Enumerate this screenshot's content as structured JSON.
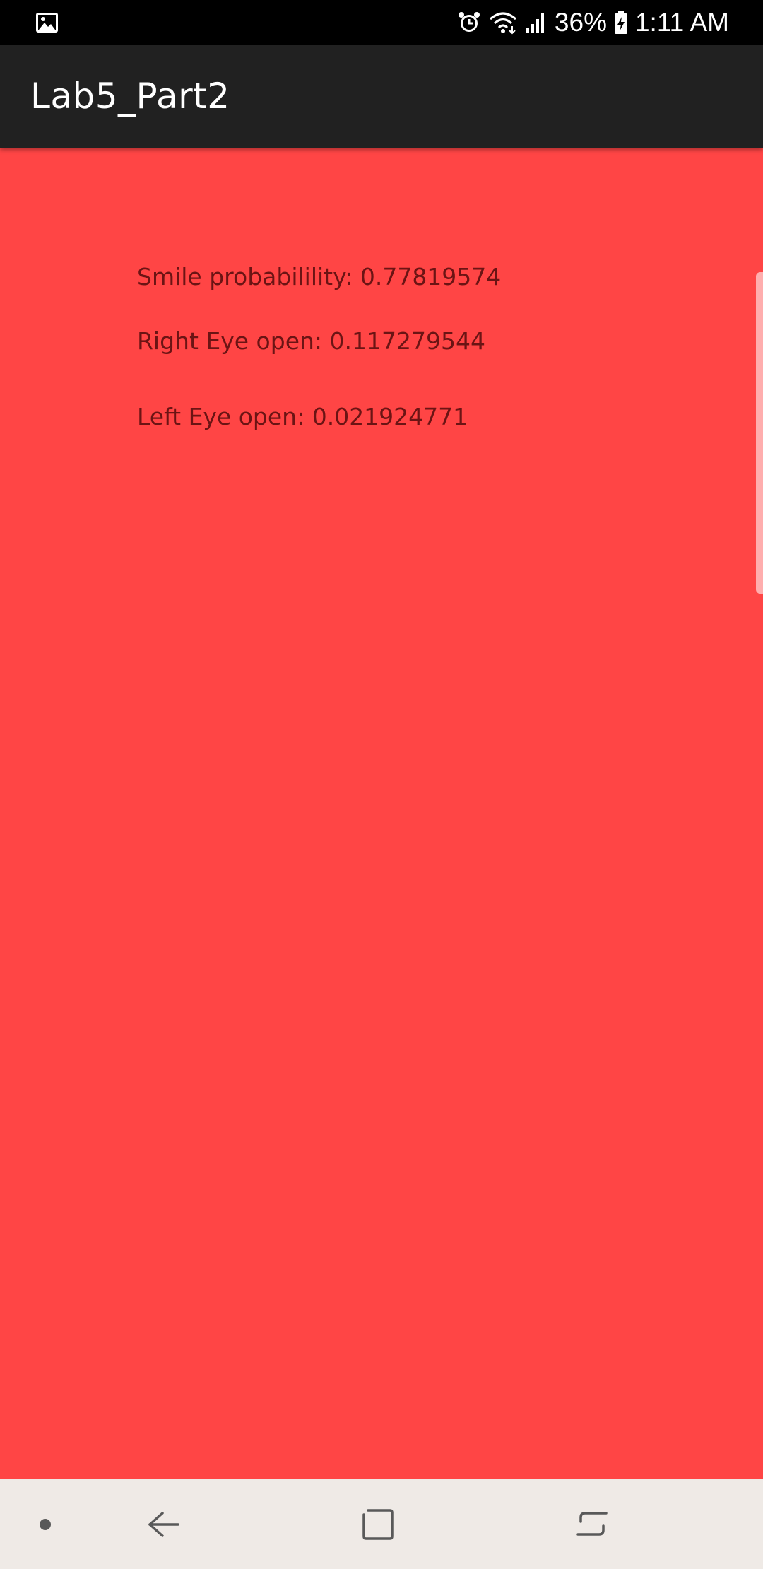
{
  "status_bar": {
    "gallery_icon": "image-icon",
    "alarm_icon": "alarm-icon",
    "wifi_icon": "wifi-icon",
    "signal_icon": "signal-icon",
    "battery_percent": "36%",
    "battery_icon": "battery-charging-icon",
    "time": "1:11 AM"
  },
  "app_bar": {
    "title": "Lab5_Part2"
  },
  "content": {
    "background_color": "#ff4545",
    "smile": "Smile probabilility: 0.77819574",
    "right_eye": "Right Eye open: 0.117279544",
    "left_eye": "Left Eye open: 0.021924771"
  },
  "nav_bar": {
    "dot_icon": "nav-dot-icon",
    "back_icon": "back-icon",
    "home_icon": "home-square-icon",
    "recents_icon": "recents-icon"
  }
}
